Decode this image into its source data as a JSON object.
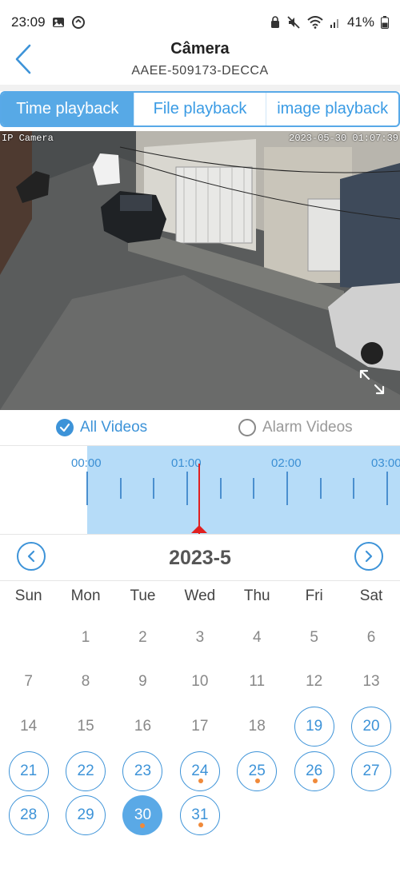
{
  "status": {
    "time": "23:09",
    "battery": "41%"
  },
  "header": {
    "title": "Câmera",
    "subtitle": "AAEE-509173-DECCA"
  },
  "tabs": [
    {
      "label": "Time playback",
      "active": true
    },
    {
      "label": "File playback",
      "active": false
    },
    {
      "label": "image playback",
      "active": false
    }
  ],
  "video": {
    "camera_label": "IP Camera",
    "timestamp": "2023-05-30 01:07:39"
  },
  "filters": {
    "all_videos": "All Videos",
    "alarm_videos": "Alarm Videos",
    "selected": "all_videos"
  },
  "timeline": {
    "labels": [
      "00:00",
      "01:00",
      "02:00",
      "03:00"
    ]
  },
  "calendar": {
    "month_title": "2023-5",
    "weekdays": [
      "Sun",
      "Mon",
      "Tue",
      "Wed",
      "Thu",
      "Fri",
      "Sat"
    ],
    "days": [
      {
        "d": "",
        "state": "empty"
      },
      {
        "d": "1",
        "state": "none"
      },
      {
        "d": "2",
        "state": "none"
      },
      {
        "d": "3",
        "state": "none"
      },
      {
        "d": "4",
        "state": "none"
      },
      {
        "d": "5",
        "state": "none"
      },
      {
        "d": "6",
        "state": "none"
      },
      {
        "d": "7",
        "state": "none"
      },
      {
        "d": "8",
        "state": "none"
      },
      {
        "d": "9",
        "state": "none"
      },
      {
        "d": "10",
        "state": "none"
      },
      {
        "d": "11",
        "state": "none"
      },
      {
        "d": "12",
        "state": "none"
      },
      {
        "d": "13",
        "state": "none"
      },
      {
        "d": "14",
        "state": "none"
      },
      {
        "d": "15",
        "state": "none"
      },
      {
        "d": "16",
        "state": "none"
      },
      {
        "d": "17",
        "state": "none"
      },
      {
        "d": "18",
        "state": "none"
      },
      {
        "d": "19",
        "state": "recorded"
      },
      {
        "d": "20",
        "state": "recorded"
      },
      {
        "d": "21",
        "state": "recorded"
      },
      {
        "d": "22",
        "state": "recorded"
      },
      {
        "d": "23",
        "state": "recorded"
      },
      {
        "d": "24",
        "state": "recorded",
        "alarm": true
      },
      {
        "d": "25",
        "state": "recorded",
        "alarm": true
      },
      {
        "d": "26",
        "state": "recorded",
        "alarm": true
      },
      {
        "d": "27",
        "state": "recorded"
      },
      {
        "d": "28",
        "state": "recorded"
      },
      {
        "d": "29",
        "state": "recorded"
      },
      {
        "d": "30",
        "state": "selected",
        "alarm": true
      },
      {
        "d": "31",
        "state": "recorded",
        "alarm": true
      }
    ]
  },
  "colors": {
    "accent": "#3d93d8",
    "tab_active": "#57a9e6",
    "alarm_dot": "#f08a3a",
    "cursor": "#e02020"
  }
}
